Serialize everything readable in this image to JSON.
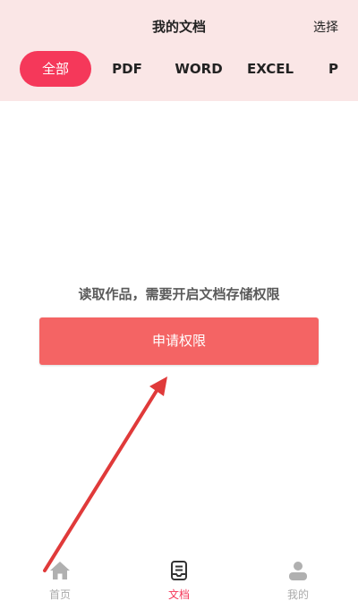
{
  "header": {
    "title": "我的文档",
    "select_label": "选择",
    "tabs": [
      "全部",
      "PDF",
      "WORD",
      "EXCEL",
      "P"
    ],
    "active_tab": "全部"
  },
  "main": {
    "permission_message": "读取作品，需要开启文档存储权限",
    "request_button_label": "申请权限"
  },
  "bottom_nav": {
    "items": [
      {
        "label": "首页",
        "icon": "home-icon"
      },
      {
        "label": "文档",
        "icon": "document-tray-icon"
      },
      {
        "label": "我的",
        "icon": "user-icon"
      }
    ],
    "active": "文档"
  },
  "colors": {
    "header_bg": "#fae6e6",
    "accent": "#f5385a",
    "button_bg": "#f46464",
    "annotation_arrow": "#e03a3a"
  }
}
